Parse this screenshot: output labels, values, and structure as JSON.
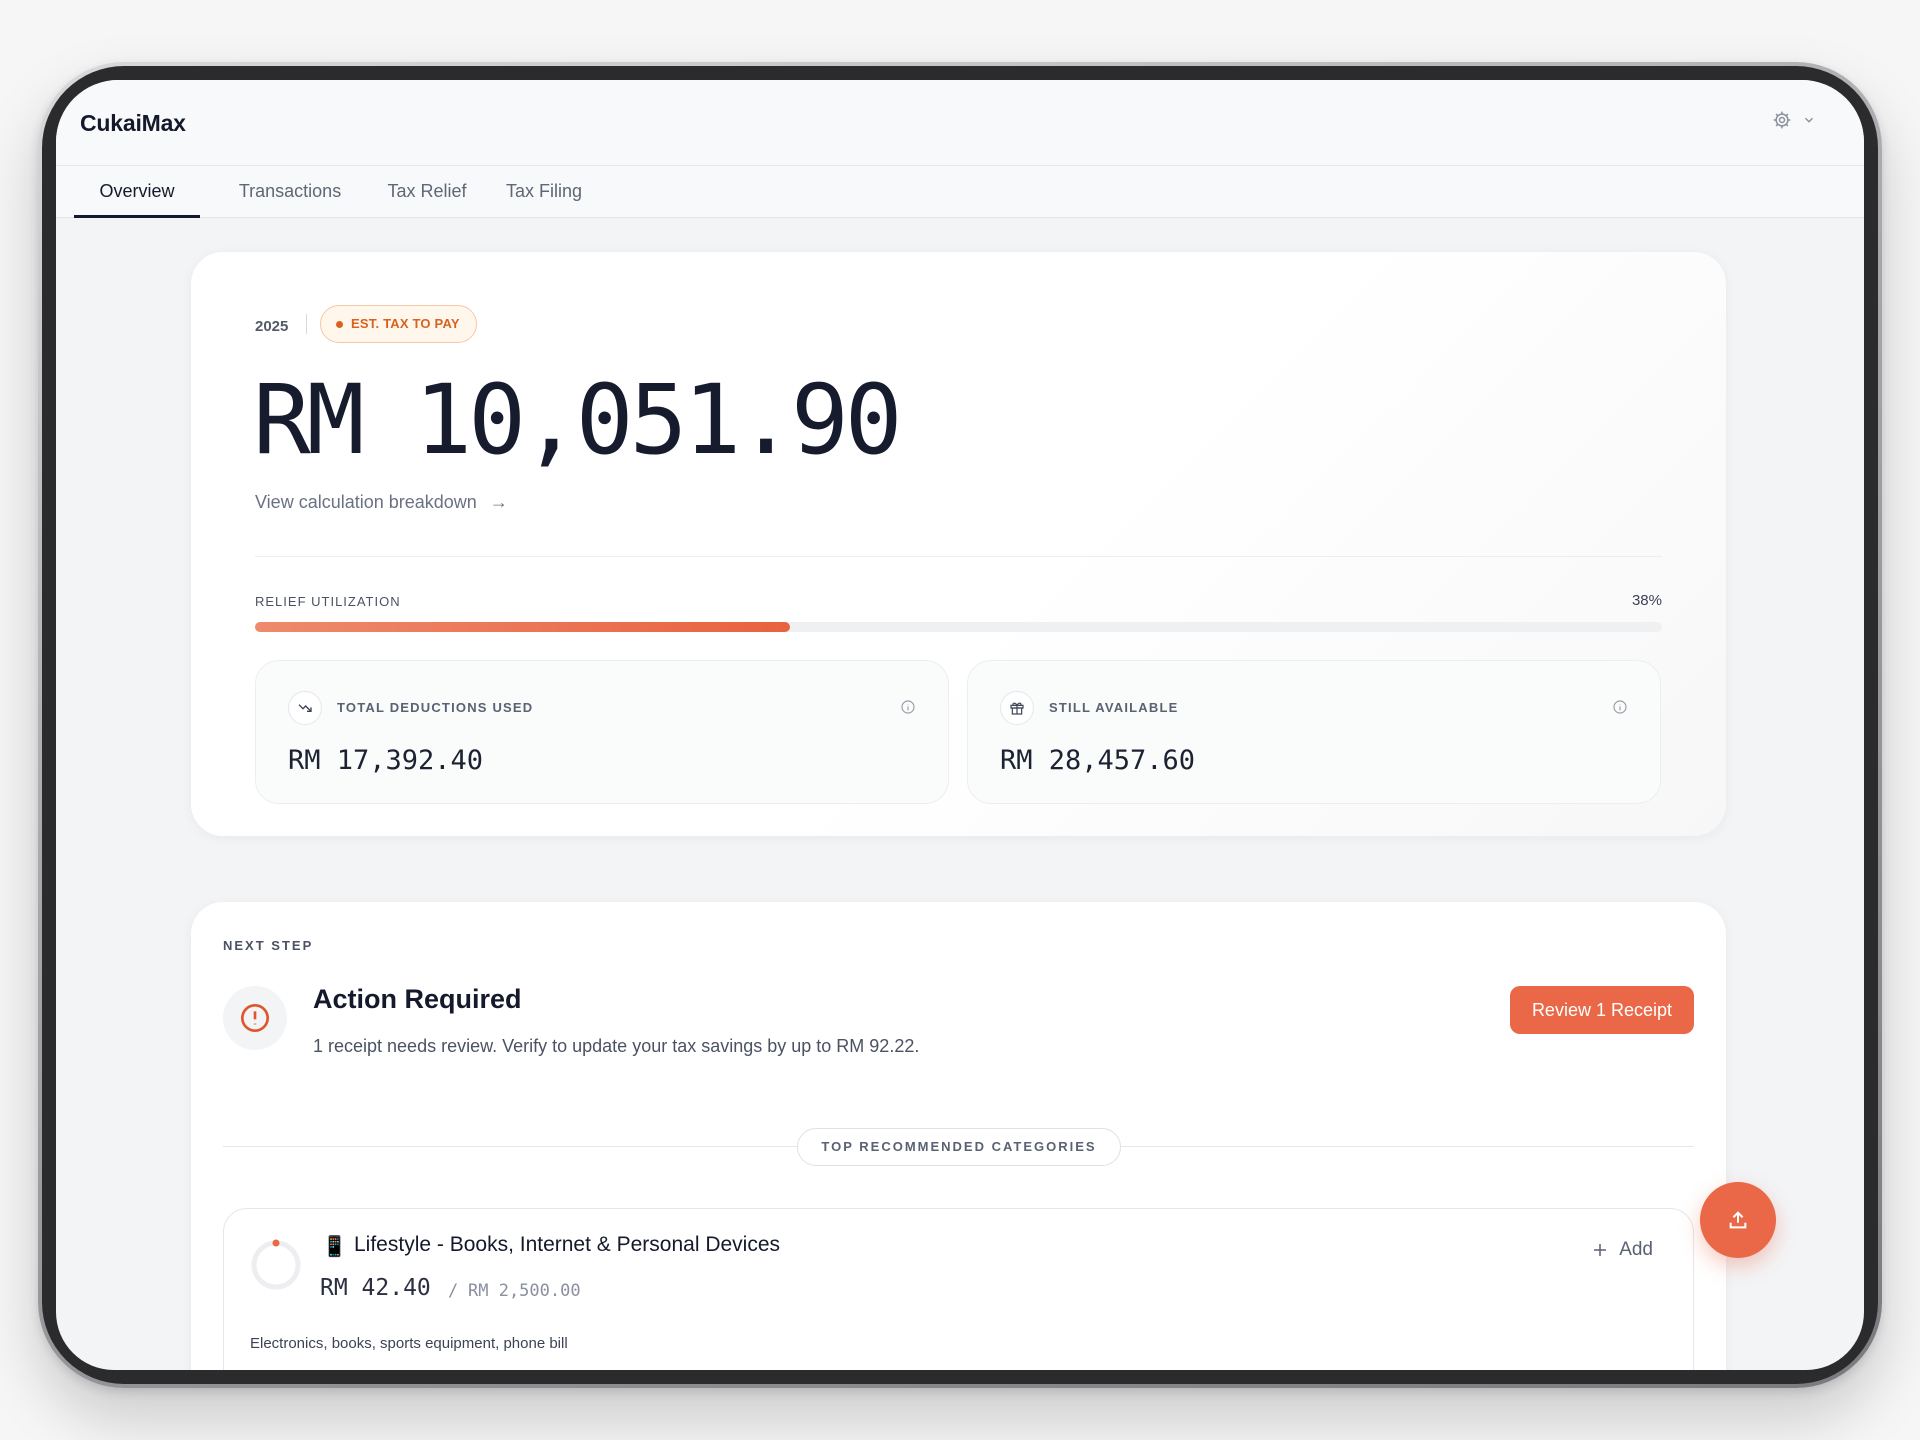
{
  "app": {
    "name": "CukaiMax"
  },
  "tabs": [
    {
      "label": "Overview",
      "active": true
    },
    {
      "label": "Transactions",
      "active": false
    },
    {
      "label": "Tax Relief",
      "active": false
    },
    {
      "label": "Tax Filing",
      "active": false
    }
  ],
  "summary": {
    "year": "2025",
    "badge": "EST. TAX TO PAY",
    "amount": "RM 10,051.90",
    "breakdown_link": "View calculation breakdown",
    "breakdown_arrow": "→",
    "relief_label": "RELIEF UTILIZATION",
    "relief_percent_text": "38%",
    "relief_fraction": 0.38,
    "stats": [
      {
        "label": "TOTAL DEDUCTIONS USED",
        "value": "RM 17,392.40",
        "icon": "trending-down-icon"
      },
      {
        "label": "STILL AVAILABLE",
        "value": "RM 28,457.60",
        "icon": "gift-icon"
      }
    ]
  },
  "next_step": {
    "label": "NEXT STEP",
    "title": "Action Required",
    "description": "1 receipt needs review. Verify to update your tax savings by up to RM 92.22.",
    "button": "Review 1 Receipt",
    "recommended_label": "TOP RECOMMENDED CATEGORIES",
    "categories": [
      {
        "icon": "📱",
        "title": "Lifestyle - Books, Internet & Personal Devices",
        "amount": "RM 42.40",
        "separator": "/",
        "limit": "RM 2,500.00",
        "add_label": "Add",
        "description": "Electronics, books, sports equipment, phone bill"
      }
    ]
  },
  "colors": {
    "accent": "#ea6847",
    "badge_text": "#d9631e",
    "text_dark": "#141a2b"
  }
}
